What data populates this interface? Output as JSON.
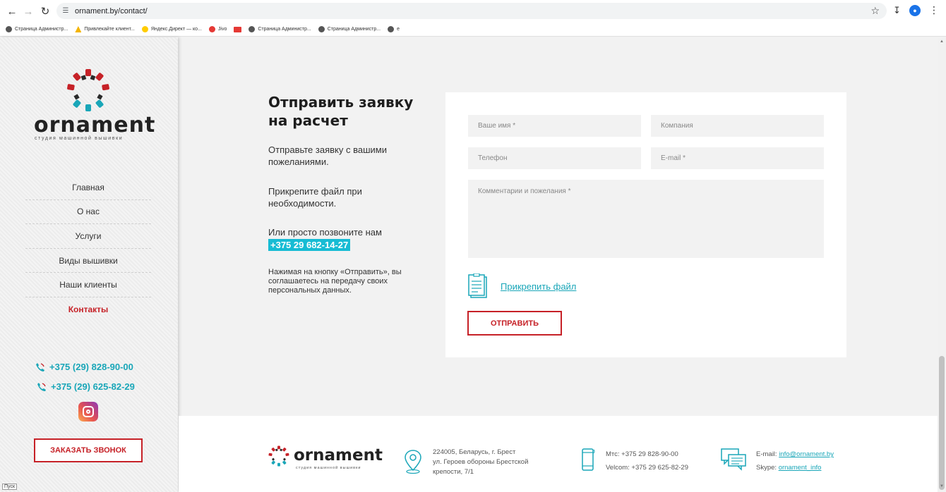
{
  "browser": {
    "url": "ornament.by/contact/",
    "bookmarks": [
      {
        "label": "Страница Администр...",
        "color": "#555555"
      },
      {
        "label": "Привлекайте клиент...",
        "color": "#f4b400"
      },
      {
        "label": "Яндекс.Директ — ко...",
        "color": "#ffcc00"
      },
      {
        "label": "Jivo",
        "color": "#e53935"
      },
      {
        "label": "",
        "color": "#e53935"
      },
      {
        "label": "Страница Администр...",
        "color": "#555555"
      },
      {
        "label": "Страница Администр...",
        "color": "#555555"
      },
      {
        "label": "е",
        "color": "#555555"
      }
    ]
  },
  "sidebar": {
    "logo_text": "ornament",
    "logo_sub": "студия машинной вышивки",
    "menu": [
      {
        "label": "Главная",
        "active": false
      },
      {
        "label": "О нас",
        "active": false
      },
      {
        "label": "Услуги",
        "active": false
      },
      {
        "label": "Виды вышивки",
        "active": false
      },
      {
        "label": "Наши клиенты",
        "active": false
      },
      {
        "label": "Контакты",
        "active": true
      }
    ],
    "phone1": "+375 (29) 828-90-00",
    "phone2": "+375 (29) 625-82-29",
    "callback_label": "ЗАКАЗАТЬ ЗВОНОК",
    "taskbar_label": "Пуск"
  },
  "main": {
    "title": "Отправить заявку на расчет",
    "p1": "Отправьте заявку с вашими пожеланиями.",
    "p2": "Прикрепите файл при необходимости.",
    "p3": "Или просто позвоните нам",
    "phone": "+375 29 682-14-27",
    "consent": "Нажимая на кнопку «Отправить», вы соглашаетесь на передачу своих персональных данных."
  },
  "form": {
    "name_placeholder": "Ваше имя *",
    "company_placeholder": "Компания",
    "phone_placeholder": "Телефон",
    "email_placeholder": "E-mail *",
    "comment_placeholder": "Комментарии и пожелания *",
    "attach_label": "Прикрепить файл",
    "submit_label": "ОТПРАВИТЬ"
  },
  "footer": {
    "logo_text": "ornament",
    "logo_sub": "студия машинной вышивки",
    "address_line1": "224005, Беларусь, г. Брест",
    "address_line2": "ул. Героев обороны Брестской",
    "address_line3": "крепости, 7/1",
    "mts": "Мтс: +375 29 828-90-00",
    "velcom": "Velcom: +375 29 625-82-29",
    "email_label": "E-mail:",
    "email": "info@ornament.by",
    "skype_label": "Skype:",
    "skype": "ornament_info"
  },
  "colors": {
    "accent_red": "#c62127",
    "accent_cyan": "#19a6b8",
    "highlight": "#17bcd4"
  }
}
